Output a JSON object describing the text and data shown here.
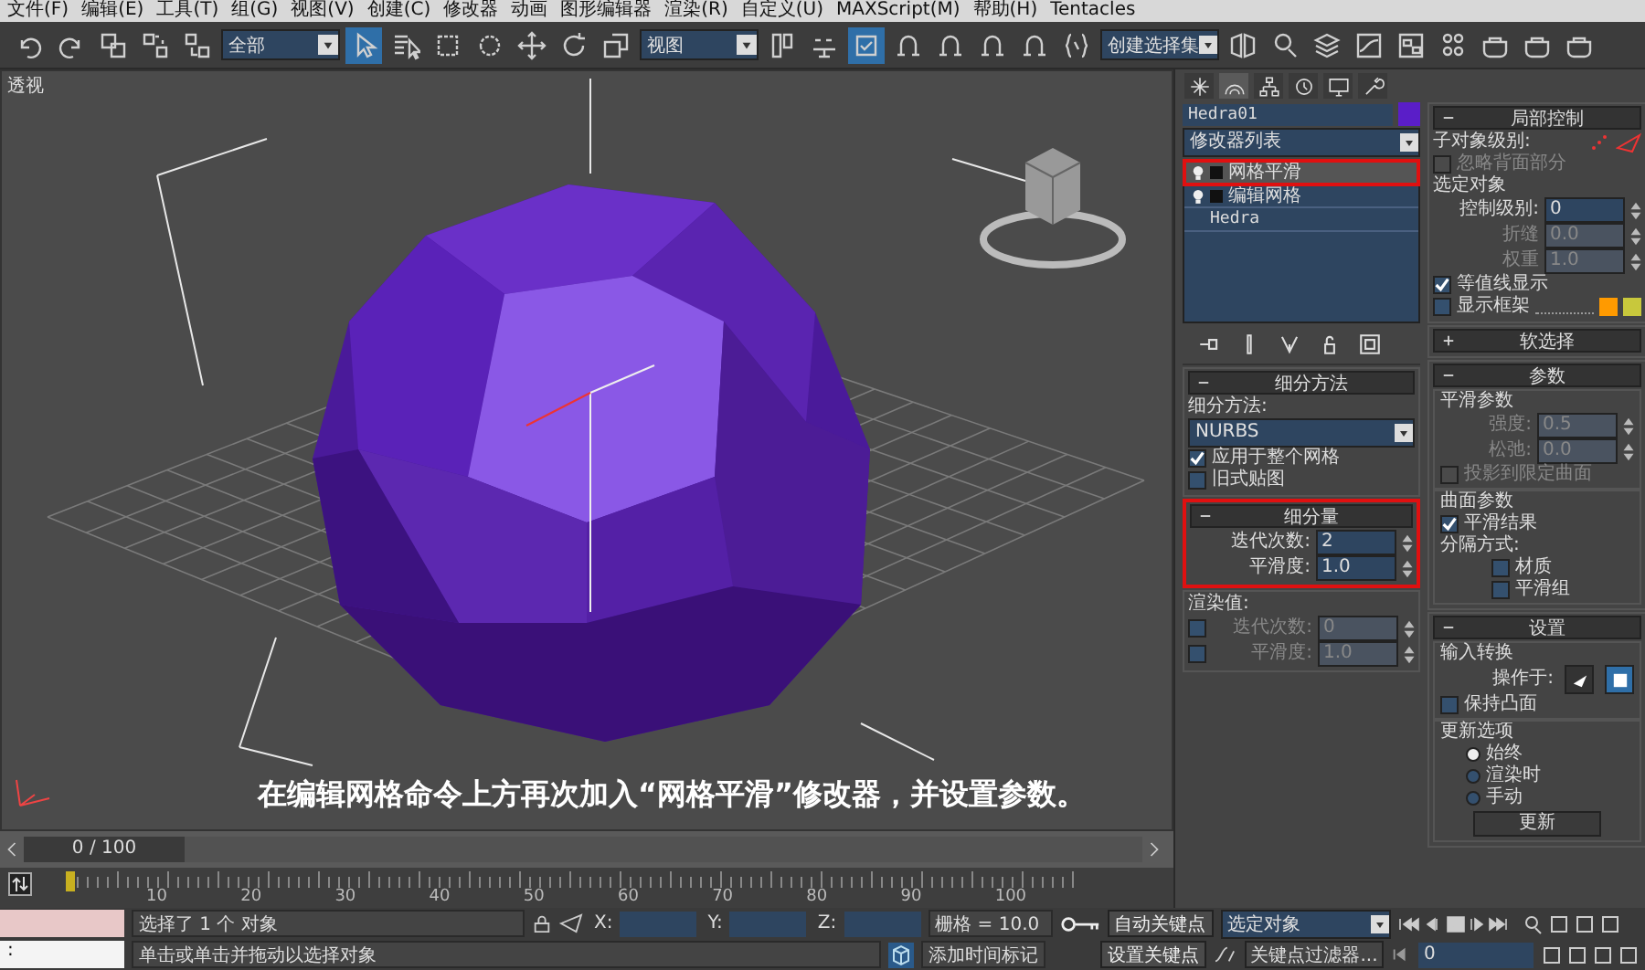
{
  "menu": [
    "文件(F)",
    "编辑(E)",
    "工具(T)",
    "组(G)",
    "视图(V)",
    "创建(C)",
    "修改器",
    "动画",
    "图形编辑器",
    "渲染(R)",
    "自定义(U)",
    "MAXScript(M)",
    "帮助(H)",
    "Tentacles"
  ],
  "toolbar": [
    {
      "kind": "icon",
      "selected": false
    },
    {
      "kind": "icon",
      "selected": false
    },
    {
      "kind": "icon",
      "selected": false
    },
    {
      "kind": "icon",
      "selected": false
    },
    {
      "kind": "icon",
      "selected": false
    },
    {
      "kind": "dropdown",
      "value": "全部"
    },
    {
      "kind": "icon",
      "selected": true
    },
    {
      "kind": "icon",
      "selected": false
    },
    {
      "kind": "icon",
      "selected": false
    },
    {
      "kind": "icon",
      "selected": false
    },
    {
      "kind": "icon",
      "selected": false
    },
    {
      "kind": "icon",
      "selected": false
    },
    {
      "kind": "icon",
      "selected": false
    },
    {
      "kind": "dropdown",
      "value": "视图"
    },
    {
      "kind": "icon",
      "selected": false
    },
    {
      "kind": "icon",
      "selected": false
    },
    {
      "kind": "icon",
      "selected": true
    },
    {
      "kind": "icon",
      "selected": false
    },
    {
      "kind": "icon",
      "selected": false
    },
    {
      "kind": "icon",
      "selected": false
    },
    {
      "kind": "icon",
      "selected": false
    },
    {
      "kind": "icon",
      "selected": false
    },
    {
      "kind": "dropdown",
      "value": "创建选择集"
    },
    {
      "kind": "icon",
      "selected": false
    },
    {
      "kind": "icon",
      "selected": false
    },
    {
      "kind": "icon",
      "selected": false
    },
    {
      "kind": "icon",
      "selected": false
    },
    {
      "kind": "icon",
      "selected": false
    },
    {
      "kind": "icon",
      "selected": false
    },
    {
      "kind": "icon",
      "selected": false
    },
    {
      "kind": "icon",
      "selected": false
    },
    {
      "kind": "icon",
      "selected": false
    }
  ],
  "viewport": {
    "label": "透视",
    "caption": "在编辑网格命令上方再次加入“网格平滑”修改器，并设置参数。"
  },
  "command_panel": {
    "tabs": [
      {
        "selected": false
      },
      {
        "selected": true
      },
      {
        "selected": false
      },
      {
        "selected": false
      },
      {
        "selected": false
      },
      {
        "selected": false
      }
    ],
    "object": {
      "name": "Hedra01",
      "color": "#5a1ec8"
    },
    "modifier_list": "修改器列表",
    "stack": [
      {
        "kind": "modifier",
        "label": "网格平滑",
        "selected": true,
        "highlighted": true
      },
      {
        "kind": "modifier",
        "label": "编辑网格",
        "selected": false,
        "highlighted": false
      },
      {
        "kind": "base",
        "label": "Hedra",
        "selected": false,
        "highlighted": false
      }
    ],
    "left_rollouts": [
      {
        "title": "细分方法",
        "expanded": true,
        "items": [
          {
            "kind": "label",
            "text": "细分方法:"
          },
          {
            "kind": "dropdown",
            "value": "NURBS"
          },
          {
            "kind": "check",
            "label": "应用于整个网格",
            "checked": true,
            "disabled": false
          },
          {
            "kind": "check",
            "label": "旧式贴图",
            "checked": false,
            "disabled": false
          }
        ]
      },
      {
        "title": "细分量",
        "expanded": true,
        "highlighted": true,
        "items": [
          {
            "kind": "spinner",
            "label": "迭代次数:",
            "value": "2",
            "disabled": false
          },
          {
            "kind": "spinner",
            "label": "平滑度:",
            "value": "1.0",
            "disabled": false
          }
        ]
      },
      {
        "items": [
          {
            "kind": "label",
            "text": "渲染值:"
          },
          {
            "kind": "check_spinner",
            "checked": false,
            "label": "迭代次数:",
            "value": "0",
            "disabled": true
          },
          {
            "kind": "check_spinner",
            "checked": false,
            "label": "平滑度:",
            "value": "1.0",
            "disabled": true
          }
        ]
      }
    ],
    "right_rollouts": [
      {
        "title": "局部控制",
        "expanded": true,
        "items": [
          {
            "kind": "subobject",
            "label": "子对象级别:"
          },
          {
            "kind": "check",
            "label": "忽略背面部分",
            "checked": false,
            "disabled": true
          },
          {
            "kind": "label",
            "text": "选定对象"
          },
          {
            "kind": "spinner",
            "label": "控制级别:",
            "value": "0",
            "disabled": false
          },
          {
            "kind": "spinner",
            "label": "折缝",
            "value": "0.0",
            "disabled": true
          },
          {
            "kind": "spinner",
            "label": "权重",
            "value": "1.0",
            "disabled": true
          },
          {
            "kind": "check",
            "label": "等值线显示",
            "checked": true,
            "disabled": false
          },
          {
            "kind": "check_colors",
            "label": "显示框架",
            "checked": false,
            "swatches": [
              {
                "color": "#ff9a00"
              },
              {
                "color": "#c8c83c"
              }
            ]
          }
        ]
      },
      {
        "title": "软选择",
        "expanded": false
      },
      {
        "title": "参数",
        "expanded": true,
        "items": [
          {
            "kind": "group",
            "title": "平滑参数",
            "items": [
              {
                "kind": "spinner",
                "label": "强度:",
                "value": "0.5",
                "disabled": true
              },
              {
                "kind": "spinner",
                "label": "松弛:",
                "value": "0.0",
                "disabled": true
              },
              {
                "kind": "check",
                "label": "投影到限定曲面",
                "checked": false,
                "disabled": true
              }
            ]
          },
          {
            "kind": "group",
            "title": "曲面参数",
            "items": [
              {
                "kind": "check",
                "label": "平滑结果",
                "checked": true,
                "disabled": false
              },
              {
                "kind": "label",
                "text": "分隔方式:",
                "children": [
                  {
                    "kind": "check",
                    "label": "材质",
                    "checked": false,
                    "disabled": false
                  },
                  {
                    "kind": "check",
                    "label": "平滑组",
                    "checked": false,
                    "disabled": false
                  }
                ]
              }
            ]
          }
        ]
      },
      {
        "title": "设置",
        "expanded": true,
        "items": [
          {
            "kind": "group",
            "title": "输入转换",
            "items": [
              {
                "kind": "operate",
                "label": "操作于:",
                "options": [
                  {
                    "selected": false
                  },
                  {
                    "selected": true
                  }
                ]
              },
              {
                "kind": "check",
                "label": "保持凸面",
                "checked": false,
                "disabled": false
              }
            ]
          },
          {
            "kind": "group",
            "title": "更新选项",
            "items": [
              {
                "kind": "radio",
                "label": "始终",
                "selected": true
              },
              {
                "kind": "radio",
                "label": "渲染时",
                "selected": false
              },
              {
                "kind": "radio",
                "label": "手动",
                "selected": false
              },
              {
                "kind": "button",
                "label": "更新"
              }
            ]
          }
        ]
      }
    ]
  },
  "timeline": {
    "position": "0 / 100",
    "level": 0,
    "ruler_labels": [
      "10",
      "20",
      "30",
      "40",
      "50",
      "60",
      "70",
      "80",
      "90",
      "100"
    ]
  },
  "status": {
    "listener_prompt": ":",
    "selection_text": "选择了 1 个 对象",
    "prompt": "单击或单击并拖动以选择对象",
    "coords": [
      "X:",
      "Y:",
      "Z:"
    ],
    "grid": "栅格 = 10.0",
    "add_time_tag": "添加时间标记",
    "auto_key": "自动关键点",
    "set_key": "设置关键点",
    "key_mode": "选定对象",
    "key_filters": "关键点过滤器...",
    "frame": "0"
  }
}
